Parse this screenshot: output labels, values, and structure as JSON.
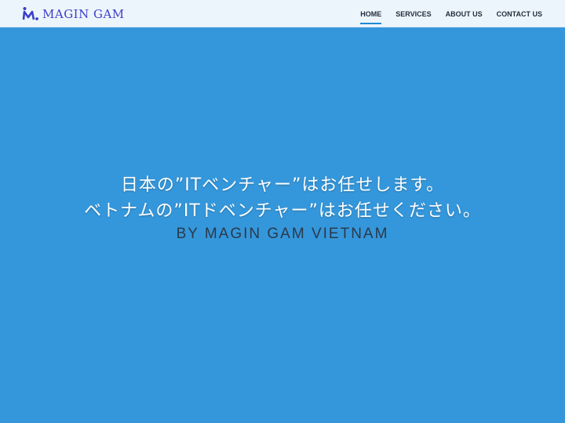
{
  "nav": {
    "brand_name": "MAGIN GAM",
    "logo_icon": "mg-logo-icon",
    "links": [
      {
        "label": "HOME",
        "active": true
      },
      {
        "label": "SERVICES",
        "active": false
      },
      {
        "label": "ABOUT US",
        "active": false
      },
      {
        "label": "CONTACT US",
        "active": false
      }
    ]
  },
  "hero": {
    "line1": "日本の”ITベンチャー”はお任せします。",
    "line2": "ベトナムの”ITドベンチャー”はお任せください。",
    "subtitle": "BY MAGIN GAM VIETNAM"
  },
  "colors": {
    "background": "#3597db",
    "navbar": "#edf5fc",
    "brand": "#3b3fc9",
    "active_underline": "#1e8ad6"
  }
}
